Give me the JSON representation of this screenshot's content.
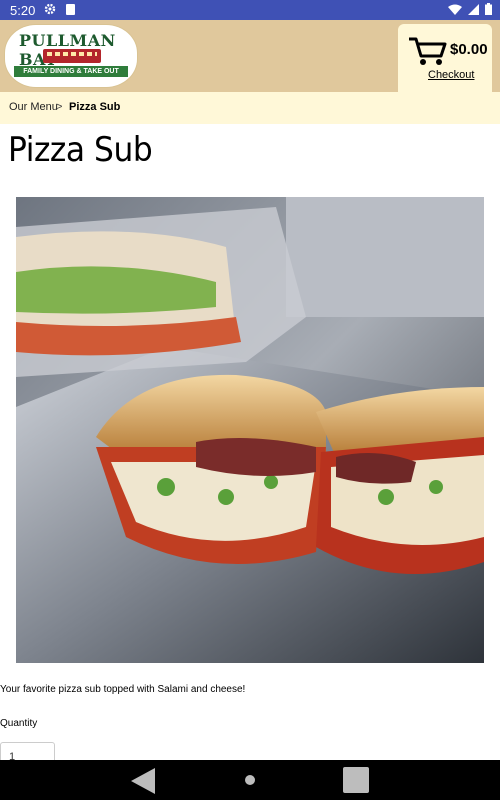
{
  "status_bar": {
    "time": "5:20",
    "icons": [
      "gear-icon",
      "sd-card-icon",
      "wifi-icon",
      "signal-icon",
      "battery-icon"
    ]
  },
  "header": {
    "logo": {
      "name": "PULLMAN BAY",
      "tagline": "FAMILY DINING & TAKE OUT"
    },
    "cart": {
      "total": "$0.00",
      "checkout_label": "Checkout"
    }
  },
  "breadcrumb": {
    "home": "Our Menu",
    "separator": ">",
    "current": "Pizza Sub"
  },
  "product": {
    "title": "Pizza Sub",
    "image_alt": "Pizza sub sandwich cut in half on foil",
    "description": "Your favorite pizza sub topped with Salami and cheese!",
    "quantity_label": "Quantity",
    "quantity_value": "1"
  },
  "colors": {
    "status_bar": "#3f51b5",
    "header": "#e0c89c",
    "breadcrumb_bg": "#fff8d8"
  }
}
